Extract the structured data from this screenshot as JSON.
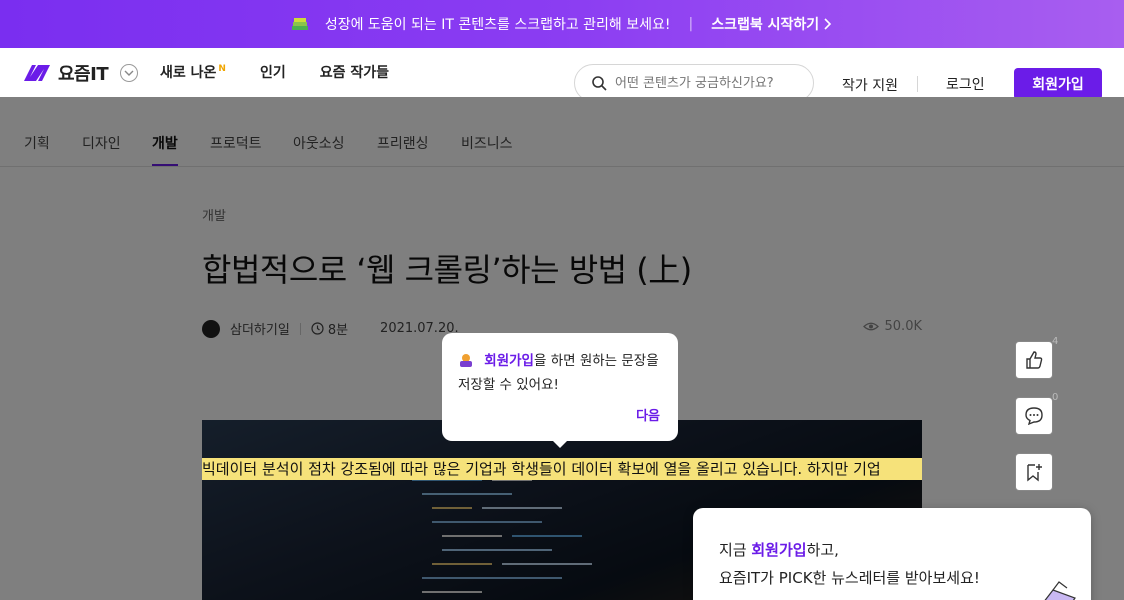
{
  "promo": {
    "text": "성장에 도움이 되는 IT 콘텐츠를 스크랩하고 관리해 보세요!",
    "separator": "|",
    "cta": "스크랩북 시작하기"
  },
  "header": {
    "logo_text": "요즘IT",
    "nav": [
      {
        "label": "새로 나온",
        "badge": "N"
      },
      {
        "label": "인기"
      },
      {
        "label": "요즘 작가들"
      }
    ],
    "search_placeholder": "어떤 콘텐츠가 궁금하신가요?",
    "writer_support": "작가 지원",
    "login": "로그인",
    "signup": "회원가입"
  },
  "categories": [
    "기획",
    "디자인",
    "개발",
    "프로덕트",
    "아웃소싱",
    "프리랜싱",
    "비즈니스"
  ],
  "active_category": "개발",
  "article": {
    "crumb": "개발",
    "title": "합법적으로 ‘웹 크롤링’하는 방법 (上)",
    "author": "삼더하기일",
    "read_time": "8분",
    "date": "2021.07.20.",
    "views": "50.0K",
    "highlight_text": "빅데이터 분석이 점차 강조됨에 따라 많은 기업과 학생들이 데이터 확보에 열을 올리고 있습니다. 하지만 기업"
  },
  "side_actions": {
    "like_count": "4",
    "comment_count": "0"
  },
  "tooltip": {
    "highlight": "회원가입",
    "text_after": "을 하면 원하는 문장을 저장할 수 있어요!",
    "next": "다음"
  },
  "newsletter": {
    "line1_prefix": "지금 ",
    "line1_highlight": "회원가입",
    "line1_suffix": "하고,",
    "line2": "요즘IT가 PICK한 뉴스레터를 받아보세요!"
  },
  "colors": {
    "accent": "#6b1ce8",
    "highlight": "#f6e27a"
  }
}
